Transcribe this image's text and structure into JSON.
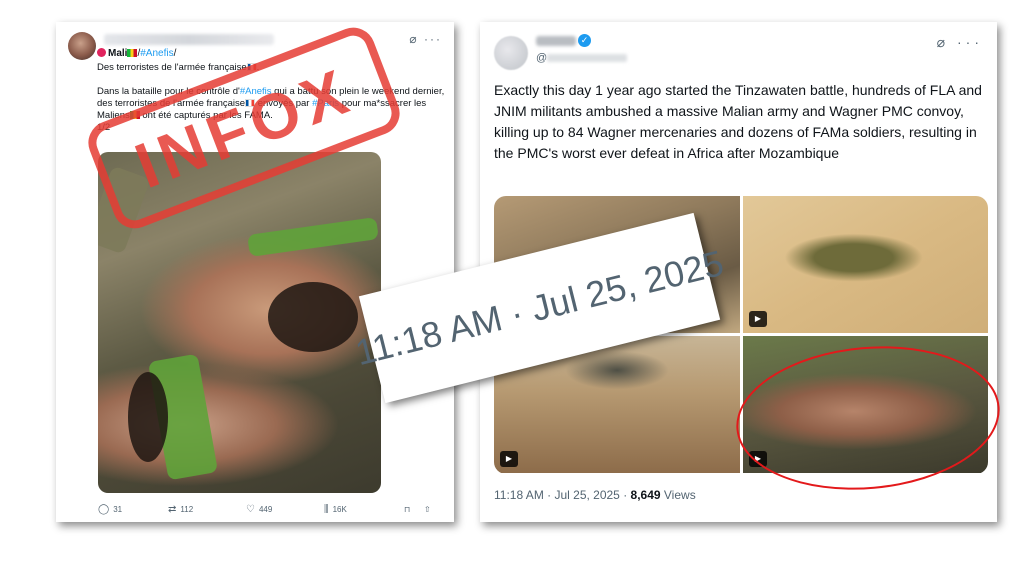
{
  "left_tweet": {
    "author_prefix": "Mali",
    "hashtag_anefis": "#Anefis",
    "slash": "/",
    "subtitle": "Des terroristes de l'armée française",
    "body_part1": "Dans la bataille pour le contrôle d'",
    "body_part2": " qui a battu son plein le weekend dernier, des terroristes de l'armée française",
    "body_part3": " envoyés par ",
    "hashtag_paris": "#Paris",
    "body_part4": " pour ma*ssacrer les Maliens",
    "body_part5": " ont été capturés par les FAMA.",
    "counter": "1/2",
    "stamp": "INFOX",
    "stats": {
      "replies": "31",
      "reposts": "112",
      "likes": "449",
      "views": "16K"
    }
  },
  "right_tweet": {
    "handle_prefix": "@",
    "text": "Exactly this day 1 year ago started the Tinzawaten battle, hundreds of FLA and JNIM militants ambushed a massive Malian army and Wagner PMC convoy, killing up to 84 Wagner mercenaries and dozens of FAMa soldiers, resulting in the PMC's worst ever defeat in Africa after Mozambique",
    "timestamp": "11:18 AM · Jul 25, 2025",
    "dot": " · ",
    "views_count": "8,649",
    "views_label": " Views"
  },
  "overlay_timestamp": "11:18 AM · Jul 25, 2025",
  "colors": {
    "stamp_red": "#e53c34",
    "ellipse_red": "#e3191b",
    "link_blue": "#1d9bf0"
  }
}
